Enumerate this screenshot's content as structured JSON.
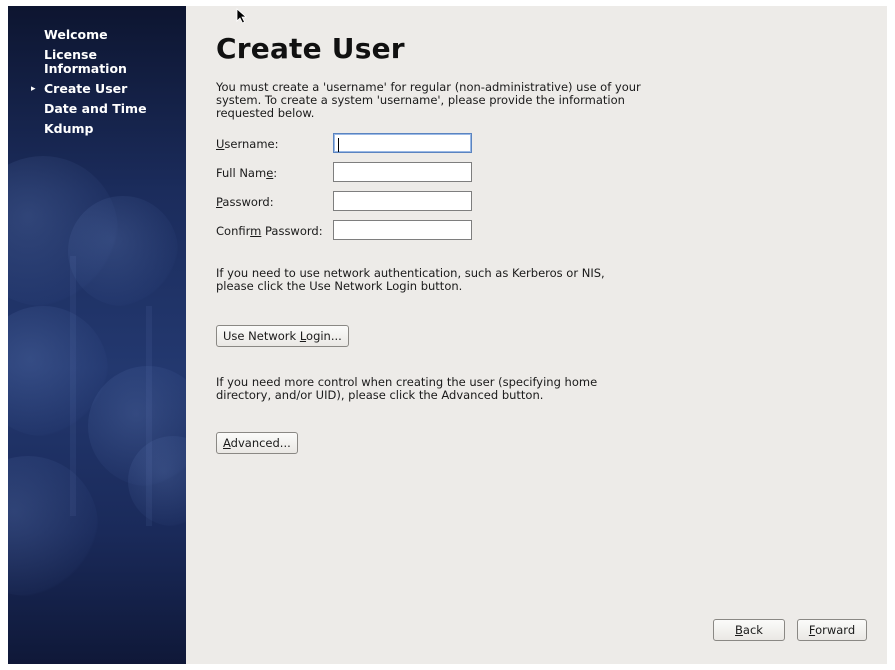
{
  "sidebar": {
    "items": [
      {
        "label": "Welcome",
        "active": false
      },
      {
        "label": "License Information",
        "active": false
      },
      {
        "label": "Create User",
        "active": true
      },
      {
        "label": "Date and Time",
        "active": false
      },
      {
        "label": "Kdump",
        "active": false
      }
    ]
  },
  "main": {
    "title": "Create User",
    "intro": "You must create a 'username' for regular (non-administrative) use of your system.  To create a system 'username', please provide the information requested below.",
    "form": {
      "username": {
        "label_pre": "",
        "label_key": "U",
        "label_post": "sername:",
        "value": ""
      },
      "full_name": {
        "label_pre": "Full Nam",
        "label_key": "e",
        "label_post": ":",
        "value": ""
      },
      "password": {
        "label_pre": "",
        "label_key": "P",
        "label_post": "assword:",
        "value": ""
      },
      "confirm_password": {
        "label_pre": "Confir",
        "label_key": "m",
        "label_post": " Password:",
        "value": ""
      }
    },
    "network_text": "If you need to use network authentication, such as Kerberos or NIS, please click the Use Network Login button.",
    "network_button": {
      "pre": "Use Network ",
      "key": "L",
      "post": "ogin..."
    },
    "advanced_text": "If you need more control when creating the user (specifying home directory, and/or UID), please click the Advanced button.",
    "advanced_button": {
      "pre": "",
      "key": "A",
      "post": "dvanced..."
    }
  },
  "footer": {
    "back_button": {
      "pre": "",
      "key": "B",
      "post": "ack"
    },
    "forward_button": {
      "pre": "",
      "key": "F",
      "post": "orward"
    }
  },
  "colors": {
    "sidebar_dark": "#0d1530",
    "sidebar_mid": "#23386f",
    "content_bg": "#edebe8"
  }
}
